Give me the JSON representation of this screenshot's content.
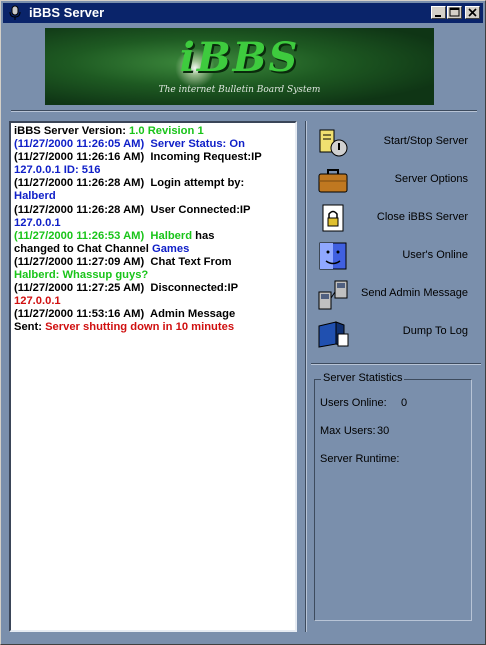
{
  "window": {
    "title": "iBBS Server"
  },
  "banner": {
    "logo": "iBBS",
    "subtitle": "The internet Bulletin Board System"
  },
  "log": [
    [
      {
        "t": "iBBS Server Version: ",
        "c": "black"
      },
      {
        "t": "1.0 Revision 1",
        "c": "green"
      }
    ],
    [
      {
        "t": "(11/27/2000 11:26:05 AM)  Server Status: On",
        "c": "blue"
      }
    ],
    [
      {
        "t": "(11/27/2000 11:26:16 AM)  Incoming Request:IP",
        "c": "black"
      }
    ],
    [
      {
        "t": "127.0.0.1 ID: 516",
        "c": "blue"
      }
    ],
    [
      {
        "t": "(11/27/2000 11:26:28 AM)  Login attempt by:",
        "c": "black"
      }
    ],
    [
      {
        "t": "Halberd",
        "c": "blue"
      }
    ],
    [
      {
        "t": "(11/27/2000 11:26:28 AM)  User Connected:IP",
        "c": "black"
      }
    ],
    [
      {
        "t": "127.0.0.1",
        "c": "blue"
      }
    ],
    [
      {
        "t": "(11/27/2000 11:26:53 AM)  Halberd",
        "c": "green"
      },
      {
        "t": " has",
        "c": "black"
      }
    ],
    [
      {
        "t": "changed to Chat Channel ",
        "c": "black"
      },
      {
        "t": "Games",
        "c": "blue"
      }
    ],
    [
      {
        "t": "(11/27/2000 11:27:09 AM)  Chat Text From",
        "c": "black"
      }
    ],
    [
      {
        "t": "Halberd: Whassup guys?",
        "c": "green"
      }
    ],
    [
      {
        "t": "(11/27/2000 11:27:25 AM)  Disconnected:IP",
        "c": "black"
      }
    ],
    [
      {
        "t": "127.0.0.1",
        "c": "red"
      }
    ],
    [
      {
        "t": "(11/27/2000 11:53:16 AM)  Admin Message",
        "c": "black"
      }
    ],
    [
      {
        "t": "Sent: ",
        "c": "black"
      },
      {
        "t": "Server shutting down in 10 minutes",
        "c": "red"
      }
    ]
  ],
  "actions": {
    "start_stop": "Start/Stop Server",
    "options": "Server Options",
    "close": "Close iBBS Server",
    "users": "User's Online",
    "admin_msg": "Send Admin Message",
    "dump": "Dump To Log"
  },
  "stats": {
    "legend": "Server Statistics",
    "users_online_label": "Users Online:",
    "users_online": "0",
    "max_users_label": "Max Users:",
    "max_users": "30",
    "runtime_label": "Server Runtime:"
  },
  "colors": {
    "background": "#7A8FAC",
    "titlebar": "#0a246a",
    "blue_text": "#1020c8",
    "green_text": "#19c419",
    "red_text": "#d01010"
  }
}
